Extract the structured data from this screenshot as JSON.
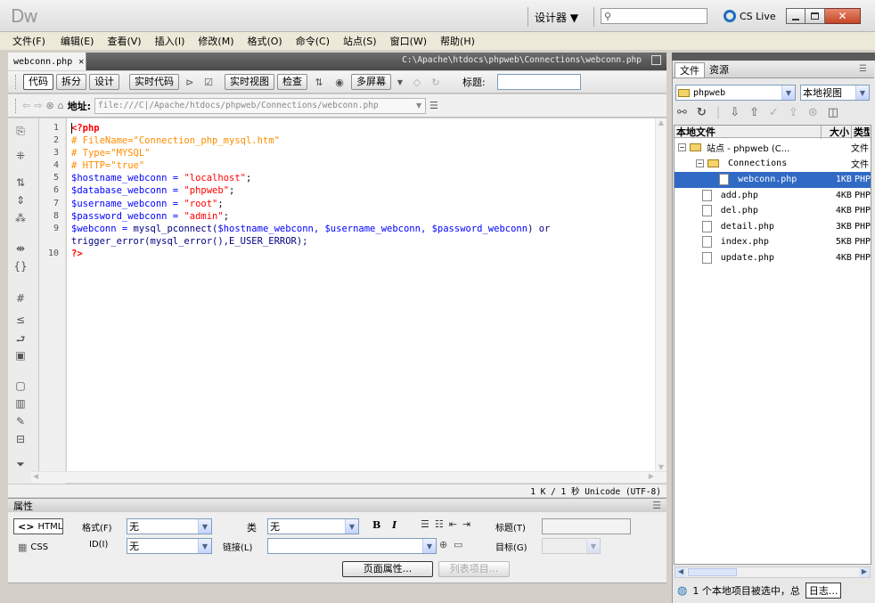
{
  "app": {
    "logo": "Dw",
    "workspace": "设计器 ▼",
    "search_placeholder": "",
    "cslive": "CS Live"
  },
  "menu": [
    "文件(F)",
    "编辑(E)",
    "查看(V)",
    "插入(I)",
    "修改(M)",
    "格式(O)",
    "命令(C)",
    "站点(S)",
    "窗口(W)",
    "帮助(H)"
  ],
  "doc": {
    "tab": "webconn.php",
    "path": "C:\\Apache\\htdocs\\phpweb\\Connections\\webconn.php"
  },
  "toolbar": {
    "code": "代码",
    "split": "拆分",
    "design": "设计",
    "livecode": "实时代码",
    "liveview": "实时视图",
    "inspect": "检查",
    "multiscreen": "多屏幕",
    "title_label": "标题:",
    "title_value": ""
  },
  "address": {
    "label": "地址:",
    "value": "file:///C|/Apache/htdocs/phpweb/Connections/webconn.php"
  },
  "code": {
    "line_numbers": [
      "1",
      "2",
      "3",
      "4",
      "5",
      "6",
      "7",
      "8",
      "9",
      "",
      "10"
    ],
    "l1": "<?php",
    "l2": "# FileName=\"Connection_php_mysql.htm\"",
    "l3": "# Type=\"MYSQL\"",
    "l4": "# HTTP=\"true\"",
    "l5a": "$hostname_webconn = ",
    "l5b": "\"localhost\"",
    "l5c": ";",
    "l6a": "$database_webconn = ",
    "l6b": "\"phpweb\"",
    "l6c": ";",
    "l7a": "$username_webconn = ",
    "l7b": "\"root\"",
    "l7c": ";",
    "l8a": "$password_webconn = ",
    "l8b": "\"admin\"",
    "l8c": ";",
    "l9a": "$webconn = ",
    "l9b": "mysql_pconnect(",
    "l9c": "$hostname_webconn, $username_webconn, $password_webconn",
    ") or": ") or",
    "l9d": ") or",
    "l9e": "trigger_error(mysql_error(),E_USER_ERROR);",
    "l10": "?>"
  },
  "status": {
    "text": "1 K / 1 秒 Unicode (UTF-8)"
  },
  "props": {
    "title": "属性",
    "html": "HTML",
    "css": "CSS",
    "format_label": "格式(F)",
    "format_value": "无",
    "class_label": "类",
    "class_value": "无",
    "id_label": "ID(I)",
    "id_value": "无",
    "link_label": "链接(L)",
    "link_value": "",
    "list_title_label": "标题(T)",
    "target_label": "目标(G)",
    "bold": "B",
    "italic": "I",
    "page_props": "页面属性...",
    "list_item": "列表项目..."
  },
  "files_panel": {
    "tabs": [
      "文件",
      "资源"
    ],
    "site": "phpweb",
    "view": "本地视图",
    "header": {
      "name": "本地文件",
      "size": "大小",
      "type": "类型"
    },
    "site_row": {
      "name": "站点 - phpweb (C...",
      "type": "文件"
    },
    "folder": {
      "name": "Connections",
      "type": "文件"
    },
    "files": [
      {
        "name": "webconn.php",
        "size": "1KB",
        "type": "PHP",
        "selected": true,
        "indent": 2
      },
      {
        "name": "add.php",
        "size": "4KB",
        "type": "PHP",
        "indent": 1
      },
      {
        "name": "del.php",
        "size": "4KB",
        "type": "PHP",
        "indent": 1
      },
      {
        "name": "detail.php",
        "size": "3KB",
        "type": "PHP",
        "indent": 1
      },
      {
        "name": "index.php",
        "size": "5KB",
        "type": "PHP",
        "indent": 1
      },
      {
        "name": "update.php",
        "size": "4KB",
        "type": "PHP",
        "indent": 1
      }
    ],
    "status": "1 个本地项目被选中，总",
    "log": "日志..."
  },
  "colors": {
    "selection": "#316ac5",
    "titlebar": "#ece9d8"
  }
}
